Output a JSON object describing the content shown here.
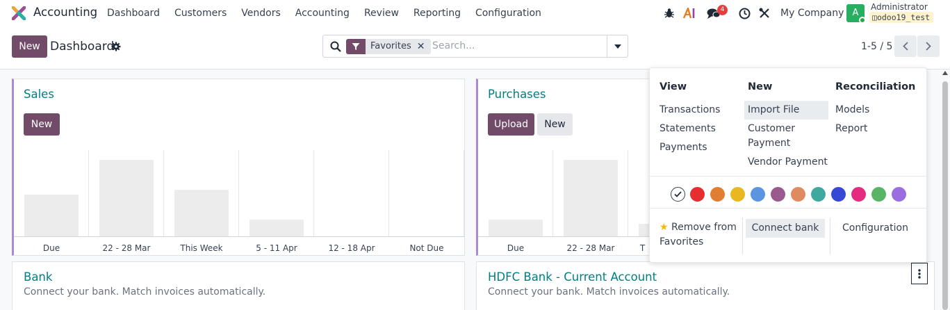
{
  "navbar": {
    "app_name": "Accounting",
    "menu": [
      "Dashboard",
      "Customers",
      "Vendors",
      "Accounting",
      "Review",
      "Reporting",
      "Configuration"
    ],
    "chat_badge": "4",
    "company": "My Company",
    "avatar_letter": "A",
    "user_name": "Administrator",
    "db_name": "odoo19_test",
    "icons": [
      "bug-icon",
      "ai-icon",
      "chat-icon",
      "clock-icon",
      "tools-icon"
    ]
  },
  "control": {
    "new_label": "New",
    "breadcrumb": "Dashboard",
    "facet_label": "Favorites",
    "search_placeholder": "Search...",
    "pager": "1-5 / 5"
  },
  "sales": {
    "title": "Sales",
    "new_label": "New",
    "chart_data": {
      "type": "bar",
      "categories": [
        "Due",
        "22 - 28 Mar",
        "This Week",
        "5 - 11 Apr",
        "12 - 18 Apr",
        "Not Due"
      ],
      "values": [
        60,
        110,
        67,
        24,
        0,
        0
      ]
    }
  },
  "purchases": {
    "title": "Purchases",
    "upload_label": "Upload",
    "new_label": "New",
    "chart_data": {
      "type": "bar",
      "categories": [
        "Due",
        "22 - 28 Mar",
        "T"
      ],
      "values": [
        24,
        110,
        18
      ]
    }
  },
  "bank": {
    "title": "Bank",
    "subtitle": "Connect your bank. Match invoices automatically."
  },
  "hdfc": {
    "title": "HDFC Bank - Current Account",
    "subtitle": "Connect your bank. Match invoices automatically."
  },
  "dropdown": {
    "view_header": "View",
    "view_items": [
      "Transactions",
      "Statements",
      "Payments"
    ],
    "new_header": "New",
    "new_items": [
      "Import File",
      "Customer Payment",
      "Vendor Payment"
    ],
    "customer_line1": "Customer",
    "customer_line2": "Payment",
    "reco_header": "Reconciliation",
    "reco_items": [
      "Models",
      "Report"
    ],
    "colors": [
      "#e62e2e",
      "#e07f32",
      "#e9b820",
      "#5b94e0",
      "#9a5a8d",
      "#e08a5f",
      "#3fa9a0",
      "#3748d7",
      "#e52b80",
      "#58b566",
      "#9a6ee0"
    ],
    "remove_line1": "Remove from",
    "remove_line2": "Favorites",
    "connect_bank": "Connect bank",
    "configuration": "Configuration"
  }
}
